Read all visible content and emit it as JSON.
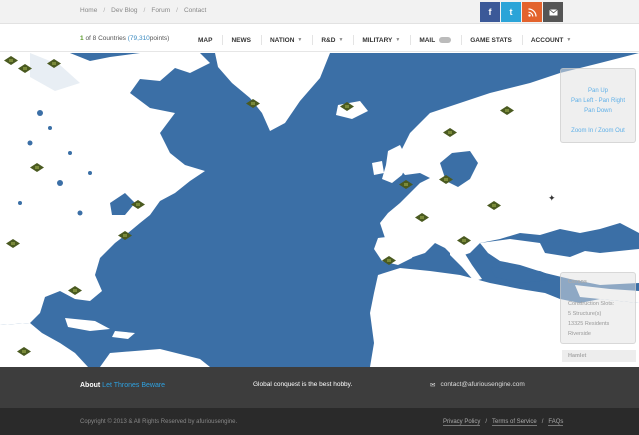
{
  "topbar": {
    "breadcrumb": [
      "Home",
      "Dev Blog",
      "Forum",
      "Contact"
    ],
    "social": [
      {
        "name": "facebook-icon",
        "glyph": "f",
        "color": "#3b5998"
      },
      {
        "name": "twitter-icon",
        "glyph": "t",
        "color": "#2ba4d8"
      },
      {
        "name": "rss-icon",
        "glyph": "◉",
        "color": "#e3632d"
      },
      {
        "name": "email-icon",
        "glyph": "✉",
        "color": "#555555"
      }
    ]
  },
  "status": {
    "rank": "1",
    "of": "of",
    "total": "8",
    "countries": "Countries",
    "points": "(79,310",
    "points_suffix": "points)"
  },
  "nav": {
    "items": [
      {
        "label": "MAP",
        "caret": false
      },
      {
        "label": "NEWS",
        "caret": false
      },
      {
        "label": "NATION",
        "caret": true
      },
      {
        "label": "R&D",
        "caret": true
      },
      {
        "label": "MILITARY",
        "caret": true
      },
      {
        "label": "MAIL",
        "caret": false,
        "toggle": true
      },
      {
        "label": "GAME STATS",
        "caret": false
      },
      {
        "label": "ACCOUNT",
        "caret": true
      }
    ]
  },
  "map": {
    "water_color": "#3b6fa6",
    "land_color": "#ffffff",
    "pan_controls": {
      "up": "Pan Up",
      "left_right": "Pan Left - Pan Right",
      "down": "Pan Down",
      "zoom": "Zoom In / Zoom Out"
    },
    "info": {
      "title": "Corsos",
      "line1": "Construction Slots:",
      "line2": "5 Structure(s)",
      "line3": "13325 Residents",
      "line4": "Riverside"
    },
    "hamlet_label": "Hamlet",
    "compass_icon": "compass-icon"
  },
  "footer": {
    "about_prefix": "About",
    "about_link": "Let Thrones Beware",
    "tagline": "Global conquest is the best hobby.",
    "contact_email": "contact@afuriousengine.com",
    "copyright": "Copyright © 2013 & All Rights Reserved by afuriousengine.",
    "legal": [
      "Privacy Policy",
      "Terms of Service",
      "FAQs"
    ]
  }
}
